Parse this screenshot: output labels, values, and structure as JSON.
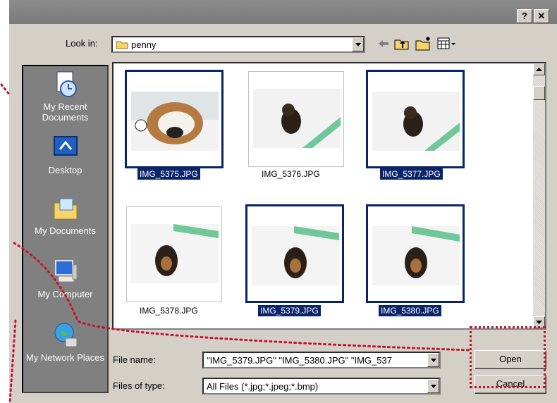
{
  "titlebar": {
    "help_label": "?",
    "close_label": "✕"
  },
  "lookin": {
    "label": "Look in:",
    "value": "penny"
  },
  "toolbar": {
    "icons": [
      "back-icon",
      "up-folder-icon",
      "new-folder-icon",
      "view-menu-icon"
    ]
  },
  "places": [
    {
      "label": "My Recent Documents",
      "icon": "recent-documents-icon"
    },
    {
      "label": "Desktop",
      "icon": "desktop-icon"
    },
    {
      "label": "My Documents",
      "icon": "my-documents-icon"
    },
    {
      "label": "My Computer",
      "icon": "my-computer-icon"
    },
    {
      "label": "My Network Places",
      "icon": "network-places-icon"
    }
  ],
  "files": [
    {
      "name": "IMG_5375.JPG",
      "selected": true
    },
    {
      "name": "IMG_5376.JPG",
      "selected": false
    },
    {
      "name": "IMG_5377.JPG",
      "selected": true
    },
    {
      "name": "IMG_5378.JPG",
      "selected": false
    },
    {
      "name": "IMG_5379.JPG",
      "selected": true
    },
    {
      "name": "IMG_5380.JPG",
      "selected": true
    }
  ],
  "filename": {
    "label": "File name:",
    "value": "\"IMG_5379.JPG\" \"IMG_5380.JPG\" \"IMG_537"
  },
  "filetype": {
    "label": "Files of type:",
    "value": "All Files (*.jpg;*.jpeg;*.bmp)"
  },
  "buttons": {
    "open": "Open",
    "cancel": "Cancel"
  },
  "colors": {
    "selection": "#0a246a",
    "annotation": "#c8102e",
    "face": "#d4d0c8"
  }
}
